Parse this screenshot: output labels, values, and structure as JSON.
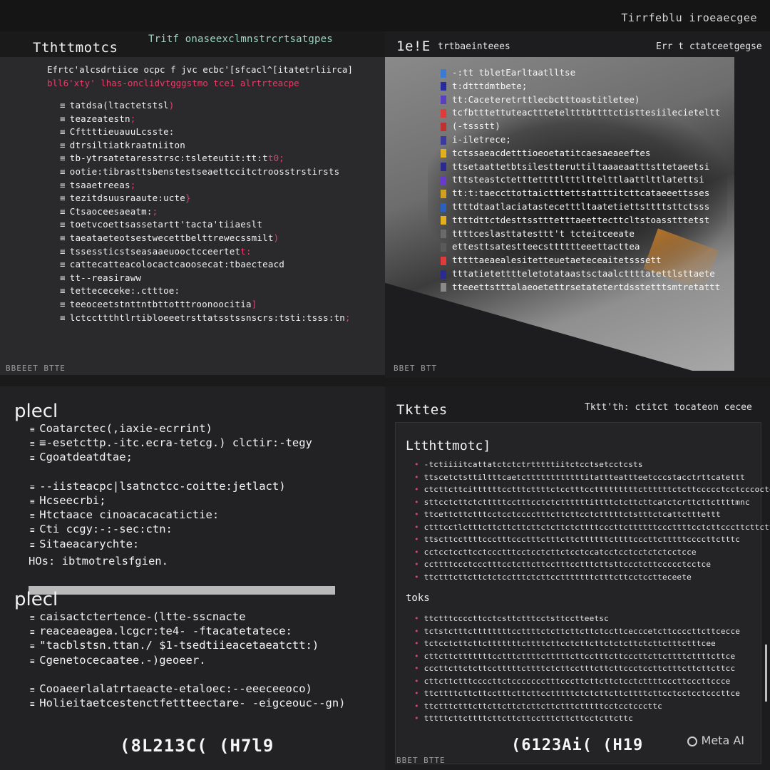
{
  "top_right": "Tirrfeblu iroeaecgee",
  "panel1": {
    "title": "Tthttmotcs",
    "meta": "Tritf onaseexclmnstrcrtsatgpes",
    "intro": [
      {
        "text": "Efrtc'alcsdrtiice ocpc f jvc ecbc'[sfcacl^[itatetrliirca]",
        "red": false
      },
      {
        "text": "bll6'xty' lhas-onclidvtgggstmo tce1 alrtrteacpe",
        "red": true
      }
    ],
    "items": [
      {
        "text": "tatdsa(ltactetstsl",
        "red": ")"
      },
      {
        "text": "teazeatestn",
        "red": ";"
      },
      {
        "text": "CfttttieuauuLcsste:",
        "red": ""
      },
      {
        "text": "dtrsiltiatkraatniiton",
        "red": ""
      },
      {
        "text": "tb-ytrsatetaresstrsc:tsleteutit:tt:t",
        "red": "t0;"
      },
      {
        "text": "ootie:tibrasttsbenstestseaettccitctroosstrstirsts",
        "red": ""
      },
      {
        "text": "tsaaetreeas",
        "red": ";"
      },
      {
        "text": "tezitdsuusraaute:ucte",
        "red": "}"
      },
      {
        "text": "Ctsaoceesaeatm:",
        "red": ";"
      },
      {
        "text": "toetvcoettsassetartt'tacta'tiiaeslt",
        "red": ""
      },
      {
        "text": "taeataeteotsestwecettbelttrewecssmilt",
        "red": ")"
      },
      {
        "text": "tssessticstseasaaeuooctcceertet",
        "red": "t:"
      },
      {
        "text": "cattecatteacolocactcaoosecat:tbaecteacd",
        "red": ""
      },
      {
        "text": "tt--reasiraww",
        "red": ""
      },
      {
        "text": "tettececeke:.ctttoe:",
        "red": ""
      },
      {
        "text": "teeoceetstnttntbttotttroonoocitia",
        "red": "]"
      },
      {
        "text": "lctccttthtlrtibloeeetrsttatsstssnscrs:tsti:tsss:tn",
        "red": ";"
      }
    ],
    "footer": "BBEEET BTTE"
  },
  "panel2": {
    "title": "1e!E",
    "subtitle": "trtbaeinteees",
    "meta": "Err t ctatceetgegse",
    "items": [
      {
        "text": "-:tt tbletEarltaatlltse",
        "color": "#3a7bd5"
      },
      {
        "text": "t:dtttdmtbete;",
        "color": "#2a2aa0"
      },
      {
        "text": "tt:Caceteretrttlecbctttoastitletee)",
        "color": "#5a3fc0"
      },
      {
        "text": "tcfbtttettuteacttteteltttbttttctisttesiilecieteltt",
        "color": "#e03a3a"
      },
      {
        "text": "(-tssstt)",
        "color": "#c03030"
      },
      {
        "text": "i-iletrece;",
        "color": "#3a3aa0"
      },
      {
        "text": "tctssaeacdetttioeoetatitcaesaeaeeftes",
        "color": "#e0b020"
      },
      {
        "text": "ttsetaattetbtsilestteruttiltaaaeaatttsttetaeetsi",
        "color": "#2a2a90"
      },
      {
        "text": "tttsteastctetttettttltttlttelttlaattlttlatettsi",
        "color": "#6a3ad0"
      },
      {
        "text": "tt:t:taeccttottaictttettstatttitcttcataeeettsses",
        "color": "#d0a020"
      },
      {
        "text": "ttttdtaatlaciatastecetttltaatetiettsttttsttctsss",
        "color": "#2a60c0"
      },
      {
        "text": "ttttdttctdesttsstttetttaeettecttcltstoasstttetst",
        "color": "#e0b020"
      },
      {
        "text": "ttttceslasttatesttt't tcteitceeate",
        "color": "#6a6a6a"
      },
      {
        "text": "ettesttsatestteecstttttteeettacttea",
        "color": "#5a5a5a"
      },
      {
        "text": "tttttaeaealesitetteuetaeteceaitetsssett",
        "color": "#e03a3a"
      },
      {
        "text": "tttatietetttteletotataastsctaalcttttatettlsttaete",
        "color": "#2a2a90"
      },
      {
        "text": "tteeettstttalaeoetettrsetatetertdsstetttsmtretattt",
        "color": "#8a8a8a"
      }
    ],
    "footer": "BBET BTT"
  },
  "panel3": {
    "heading1": "plecl",
    "list1": [
      "Coatarctec(,iaxie-ecrrint)",
      "≡-esetcttp.-itc.ecra-tetcg.) clctir:-tegy",
      "Cgoatdeatdtae;",
      "",
      "--iisteacpc|lsatnctcc-coitte:jetlact)",
      "Hcseecrbi;",
      "Htctaace cinoacacacatictie:",
      "Cti ccgy:-:-sec:ctn:",
      "Sitaeacarychte:"
    ],
    "note": "HOs: ibtmotrelsfgien.",
    "heading2": "plecl",
    "list2": [
      "caisactctertence-(ltte-sscnacte",
      "reaceaeagea.lcgcr:te4- -ftacatetatece:",
      "\"tacblstsn.ttan./ $1-tsedtiieacetaeatctt:)",
      "Cgenetocecaatee.-)geoeer.",
      "",
      "Cooaeerlalatrtaeacte-etaloec:--eeeceeoco)",
      "Holieitaetcestenctfettteectare- -eigceouc--gn)"
    ],
    "big": "(8L213C( (H7l9"
  },
  "panel4": {
    "title": "Tkttes",
    "meta": "Tktt'th: ctitct tocateon cecee",
    "h1": "Ltthttmotc]",
    "list1": [
      "-tctiiiitcattatctctctrtttttiitctcctsetcctcsts",
      "ttscetctsttiltttcaetcttttttttttttitattteattteetcccstacctrttcatettt",
      "ctcttcttcittttttcctttcttttctcctttcctttttttttcttttttctcttccccctcctcccoctetttc",
      "sttcctcttctctttttcctttcctctcttttttittttctcttcttcatctcrttcttcttttmnc",
      "ttcettcttctttcctcctcccctttcttcttcctctttttctstttctcattctttettt",
      "ctttcctlctttcttcttcttcttctcttctcttttcccttcttttttcccttttcctcttcccttcttcttcc",
      "ttscttccttttccctttccctttctttcttcttttttcttttcccttctttttccccttctttc",
      "cctcctccttcctccctttcctcctcttctcctccatcctcctcctctctcctcce",
      "ccttttccctccctttcctcttcttcctttcctttcttsttccctcttccccctcctce",
      "ttctttcttcttctctcctttctcttcctttttttctttcttcctcctteceete"
    ],
    "h2": "toks",
    "list2": [
      "ttctttccccttcctcsttctttcctsttcctteetsc",
      "tctstctttcttttttttccttttctcttcttcttctccttcecccetcttccccttcttcecce",
      "tctcctcttcttctttttttcttttcttcctcttcttctctcttctcttctttctttcee",
      "cttcttctttttttcctttcttttctttttcttcctttcttcccttcttcttttcttttcttce",
      "cccttcttctcttcctttttcttttctcttcctttcttcttccctccttctttcttcttcttcc",
      "cttcttctttccccttctccccccctttcccttcttcttctcctcttttcccttcccttccce",
      "ttcttttcttcttcctttcttcttcctttttctctcttcttcttttcttcctcctcctcccttce",
      "ttctttctttcttcttcttctcttcttctttctttttcctcctcccttc",
      "tttttcttcttttcttcttcttcctttcttcttcctcttcttc"
    ],
    "big": "(6123Ai( (H19",
    "footer": "BBET BTTE",
    "brand": "Meta AI"
  }
}
